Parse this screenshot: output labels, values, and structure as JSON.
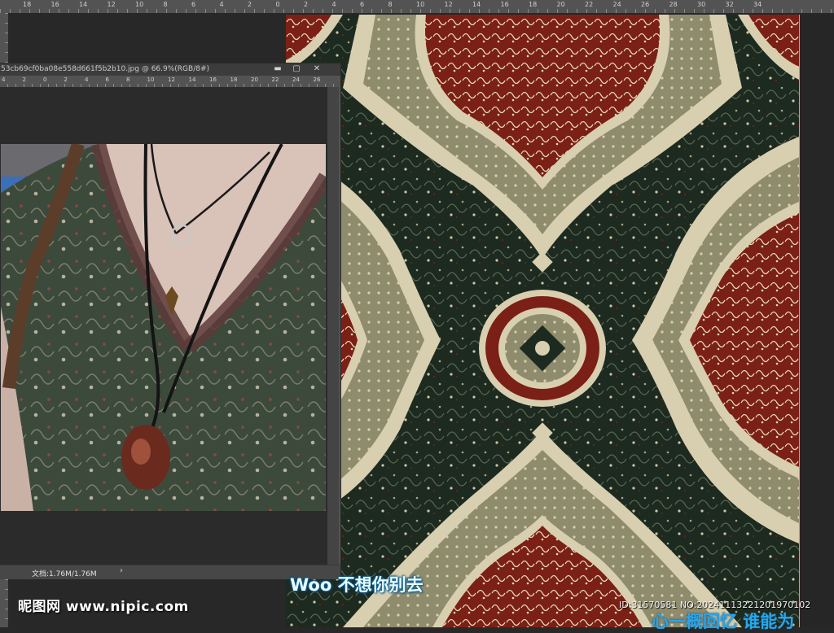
{
  "top_ruler": {
    "ticks": [
      "18",
      "16",
      "14",
      "12",
      "10",
      "8",
      "6",
      "4",
      "2",
      "0",
      "2",
      "4",
      "6",
      "8",
      "10",
      "12",
      "14",
      "16",
      "18",
      "20",
      "22",
      "24",
      "26",
      "28",
      "30",
      "32",
      "34"
    ]
  },
  "document_window": {
    "title": "53cb69cf0ba08e558d661f5b2b10.jpg @ 66.9%(RGB/8#)",
    "minimize_icon": "minimize-icon",
    "maximize_icon": "maximize-icon",
    "close_icon": "close-icon",
    "ruler_ticks": [
      "4",
      "2",
      "0",
      "2",
      "4",
      "6",
      "8",
      "10",
      "12",
      "14",
      "16",
      "18",
      "20",
      "22",
      "24",
      "26"
    ],
    "status_text": "文档:1.76M/1.76M",
    "status_arrow": "›"
  },
  "overlays": {
    "lyric": "Woo 不想你别去",
    "lyric_partial": "心一概回忆 谁能为",
    "watermark": "昵图网 www.nipic.com",
    "photo_id": "ID:31570581 NO:20241113221201970102"
  },
  "colors": {
    "ps_background": "#282828",
    "ruler": "#535353",
    "guide": "#3fd3e0",
    "pattern_dark_green": "#1d2a20",
    "pattern_red": "#7a2016",
    "pattern_cream": "#d8cfb0",
    "pattern_olive": "#8f8c6d"
  }
}
